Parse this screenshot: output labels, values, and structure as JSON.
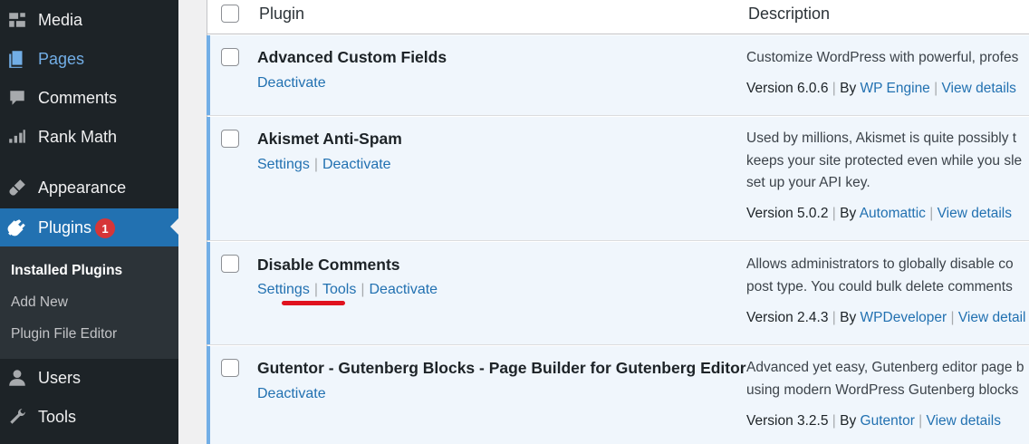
{
  "sidebar": {
    "items": [
      {
        "label": "Media",
        "icon": "media-icon"
      },
      {
        "label": "Pages",
        "icon": "pages-icon"
      },
      {
        "label": "Comments",
        "icon": "comments-icon"
      },
      {
        "label": "Rank Math",
        "icon": "rank-math-icon"
      },
      {
        "label": "Appearance",
        "icon": "appearance-icon"
      },
      {
        "label": "Plugins",
        "icon": "plugins-icon",
        "badge": "1"
      },
      {
        "label": "Users",
        "icon": "users-icon"
      },
      {
        "label": "Tools",
        "icon": "tools-icon"
      }
    ],
    "submenu": [
      {
        "label": "Installed Plugins"
      },
      {
        "label": "Add New"
      },
      {
        "label": "Plugin File Editor"
      }
    ]
  },
  "table": {
    "headers": {
      "plugin": "Plugin",
      "description": "Description"
    },
    "rows": [
      {
        "name": "Advanced Custom Fields",
        "actions": [
          "Deactivate"
        ],
        "description": [
          "Customize WordPress with powerful, profes"
        ],
        "version": "Version 6.0.6",
        "by": "By",
        "author": "WP Engine",
        "details": "View details"
      },
      {
        "name": "Akismet Anti-Spam",
        "actions": [
          "Settings",
          "Deactivate"
        ],
        "description": [
          "Used by millions, Akismet is quite possibly t",
          "keeps your site protected even while you sle",
          "set up your API key."
        ],
        "version": "Version 5.0.2",
        "by": "By",
        "author": "Automattic",
        "details": "View details"
      },
      {
        "name": "Disable Comments",
        "actions": [
          "Settings",
          "Tools",
          "Deactivate"
        ],
        "description": [
          "Allows administrators to globally disable co",
          "post type. You could bulk delete comments"
        ],
        "version": "Version 2.4.3",
        "by": "By",
        "author": "WPDeveloper",
        "details": "View detail"
      },
      {
        "name": "Gutentor - Gutenberg Blocks - Page Builder for Gutenberg Editor",
        "actions": [
          "Deactivate"
        ],
        "description": [
          "Advanced yet easy, Gutenberg editor page b",
          "using modern WordPress Gutenberg blocks"
        ],
        "version": "Version 3.2.5",
        "by": "By",
        "author": "Gutentor",
        "details": "View details"
      }
    ]
  },
  "colors": {
    "accent": "#2271b1",
    "sidebar": "#1d2327",
    "badge": "#d63638",
    "highlight_mark": "#e0121e"
  }
}
